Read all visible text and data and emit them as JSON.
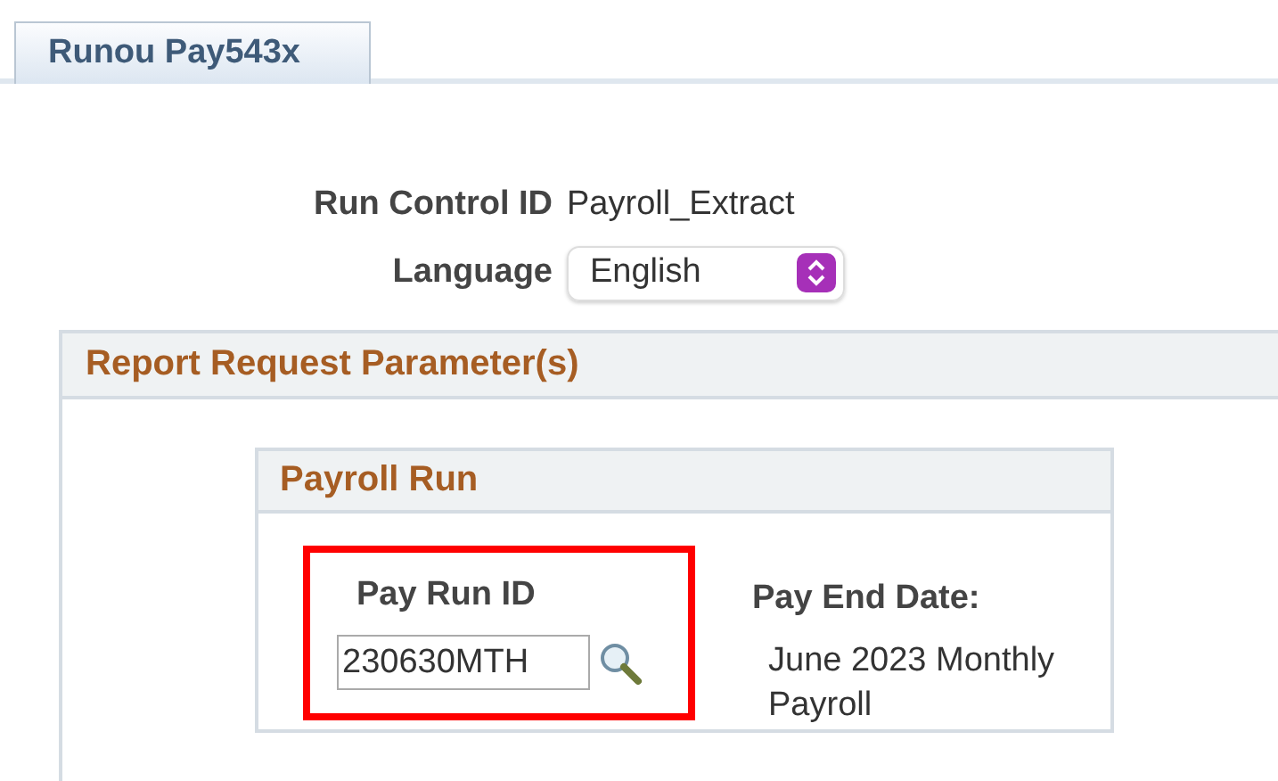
{
  "tabs": [
    {
      "label": "Runou Pay543x",
      "selected": true
    }
  ],
  "run_control": {
    "label": "Run Control ID",
    "value": "Payroll_Extract"
  },
  "language": {
    "label": "Language",
    "value": "English"
  },
  "section": {
    "title": "Report Request Parameter(s)",
    "group": {
      "title": "Payroll Run",
      "pay_run_id": {
        "label": "Pay Run ID",
        "value": "230630MTH",
        "highlighted": true
      },
      "pay_end_date": {
        "label": "Pay End Date:",
        "value": "June 2023 Monthly Payroll"
      }
    }
  }
}
